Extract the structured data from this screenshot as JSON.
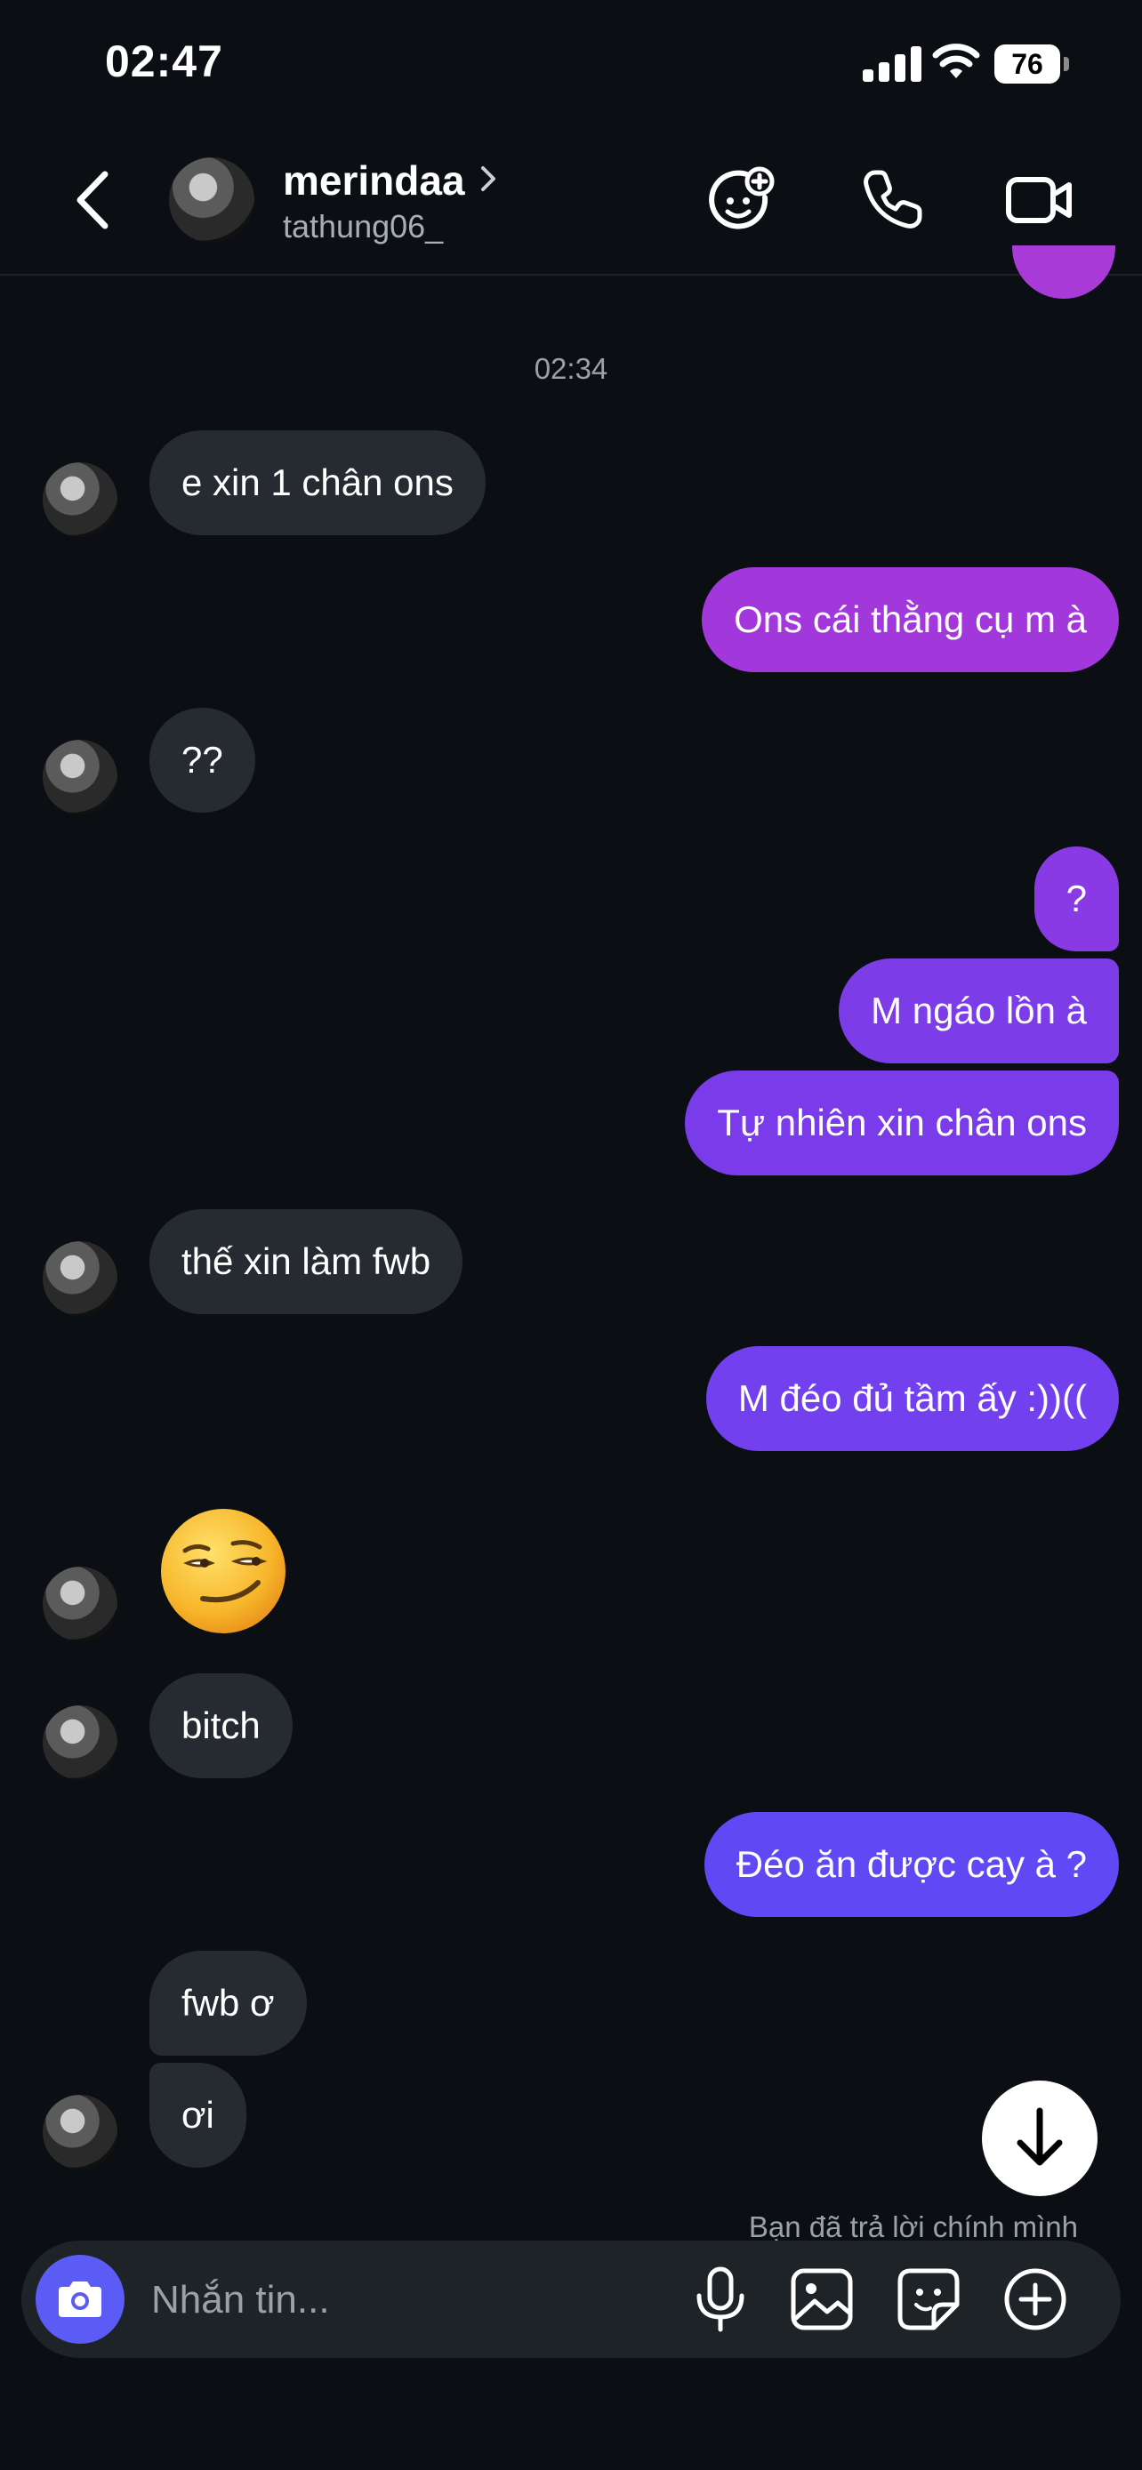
{
  "status_bar": {
    "time": "02:47",
    "battery": "76"
  },
  "header": {
    "name": "merindaa",
    "username": "tathung06_"
  },
  "thread": {
    "timestamp": "02:34",
    "messages": [
      {
        "from": "them",
        "text": "e xin 1 chân ons"
      },
      {
        "from": "me",
        "text": "Ons cái thằng cụ m à"
      },
      {
        "from": "them",
        "text": "??"
      },
      {
        "from": "me",
        "text": "?"
      },
      {
        "from": "me",
        "text": "M ngáo lồn à"
      },
      {
        "from": "me",
        "text": "Tự nhiên xin chân ons"
      },
      {
        "from": "them",
        "text": "thế xin làm fwb"
      },
      {
        "from": "me",
        "text": "M đéo đủ tầm ấy :))(("
      },
      {
        "from": "them",
        "text": "😏"
      },
      {
        "from": "them",
        "text": "bitch"
      },
      {
        "from": "me",
        "text": "Đéo ăn được cay à ?"
      },
      {
        "from": "them",
        "text": "fwb ơ"
      },
      {
        "from": "them",
        "text": "ơi"
      }
    ],
    "reply_note": "Bạn đã trả lời chính mình"
  },
  "composer": {
    "placeholder": "Nhắn tin..."
  },
  "icons": {
    "back": "chevron-left-icon",
    "effects": "face-plus-icon",
    "call": "phone-icon",
    "video": "video-camera-icon",
    "camera": "camera-icon",
    "mic": "microphone-icon",
    "gallery": "image-icon",
    "sticker": "sticker-icon",
    "more": "plus-circle-icon",
    "scroll": "arrow-down-icon"
  },
  "colors": {
    "background": "#0b0f14",
    "incoming_bubble": "#262b31",
    "outgoing_top": "#a83ad8",
    "outgoing_bottom": "#6a4cf6",
    "camera_button": "#5b5cf6"
  }
}
